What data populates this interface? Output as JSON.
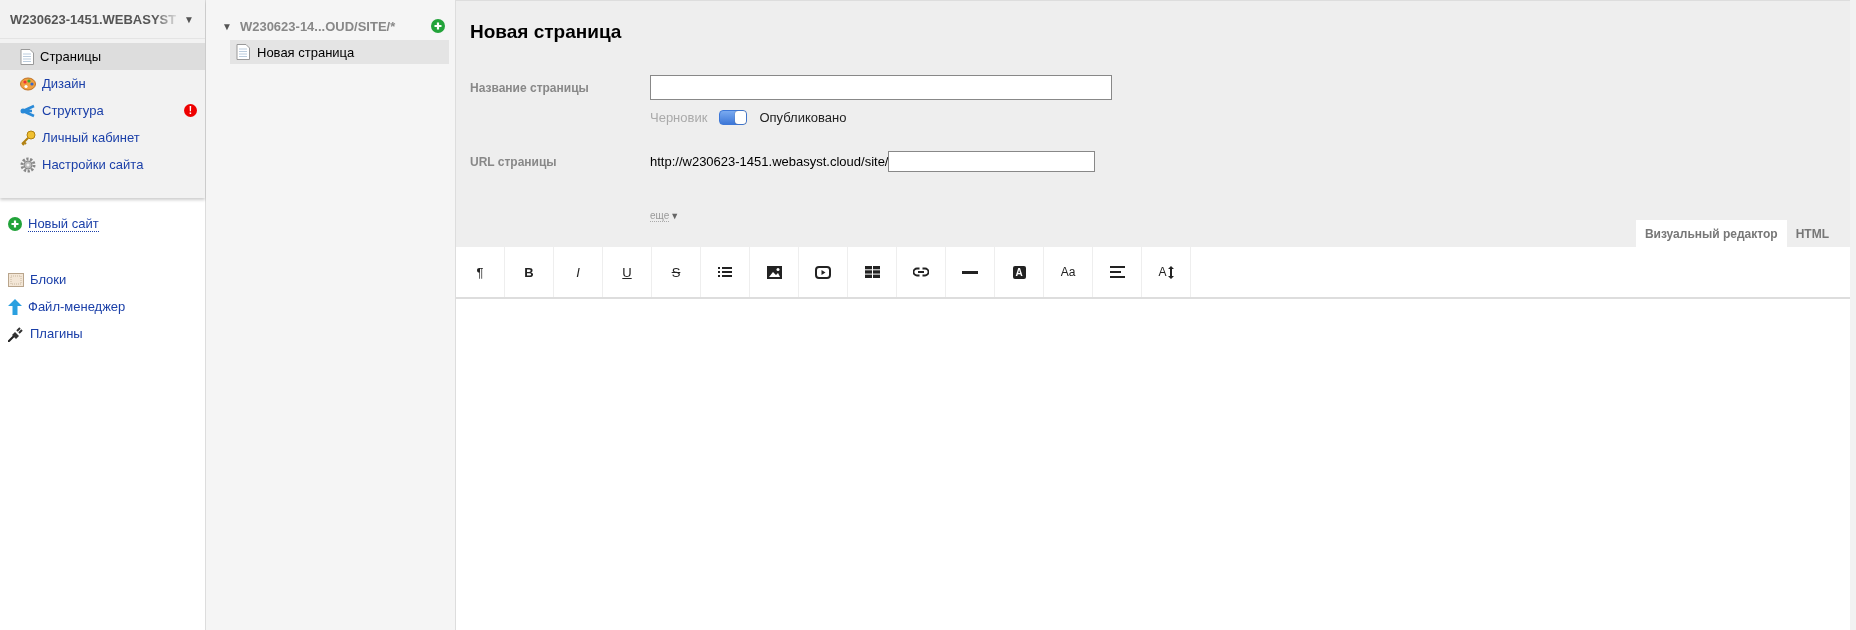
{
  "sidebar": {
    "site_title": "W230623-1451.WEBASYST",
    "site_caret": "▼",
    "items": [
      {
        "label": "Страницы",
        "kind": "page",
        "selected": true
      },
      {
        "label": "Дизайн",
        "kind": "palette",
        "selected": false
      },
      {
        "label": "Структура",
        "kind": "structure",
        "selected": false,
        "alert": "!"
      },
      {
        "label": "Личный кабинет",
        "kind": "key",
        "selected": false
      },
      {
        "label": "Настройки сайта",
        "kind": "gear",
        "selected": false
      }
    ],
    "new_site": "Новый сайт",
    "tools": [
      {
        "label": "Блоки",
        "kind": "blocks"
      },
      {
        "label": "Файл-менеджер",
        "kind": "upload"
      },
      {
        "label": "Плагины",
        "kind": "plug"
      }
    ]
  },
  "tree": {
    "caret": "▼",
    "title": "W230623-14...OUD/SITE/*",
    "pages": [
      {
        "label": "Новая страница",
        "selected": true
      }
    ]
  },
  "editor": {
    "title": "Новая страница",
    "name_label": "Название страницы",
    "status": {
      "off_label": "Черновик",
      "on_label": "Опубликовано",
      "on": true
    },
    "url_label": "URL страницы",
    "url_prefix": "http://w230623-1451.webasyst.cloud/site/",
    "more": "еще",
    "more_arrow": "▼",
    "tabs": [
      {
        "label": "Визуальный редактор",
        "selected": true
      },
      {
        "label": "HTML",
        "selected": false
      }
    ],
    "toolbar": [
      {
        "kind": "plain",
        "text": "¶"
      },
      {
        "kind": "bold",
        "text": "B"
      },
      {
        "kind": "italic",
        "text": "I"
      },
      {
        "kind": "underline",
        "text": "U"
      },
      {
        "kind": "strike",
        "text": "S"
      },
      {
        "kind": "list"
      },
      {
        "kind": "image"
      },
      {
        "kind": "video"
      },
      {
        "kind": "table"
      },
      {
        "kind": "link"
      },
      {
        "kind": "rule"
      },
      {
        "kind": "badge",
        "text": "A"
      },
      {
        "kind": "small",
        "text": "Aa"
      },
      {
        "kind": "align"
      },
      {
        "kind": "size",
        "text": "A"
      }
    ]
  }
}
